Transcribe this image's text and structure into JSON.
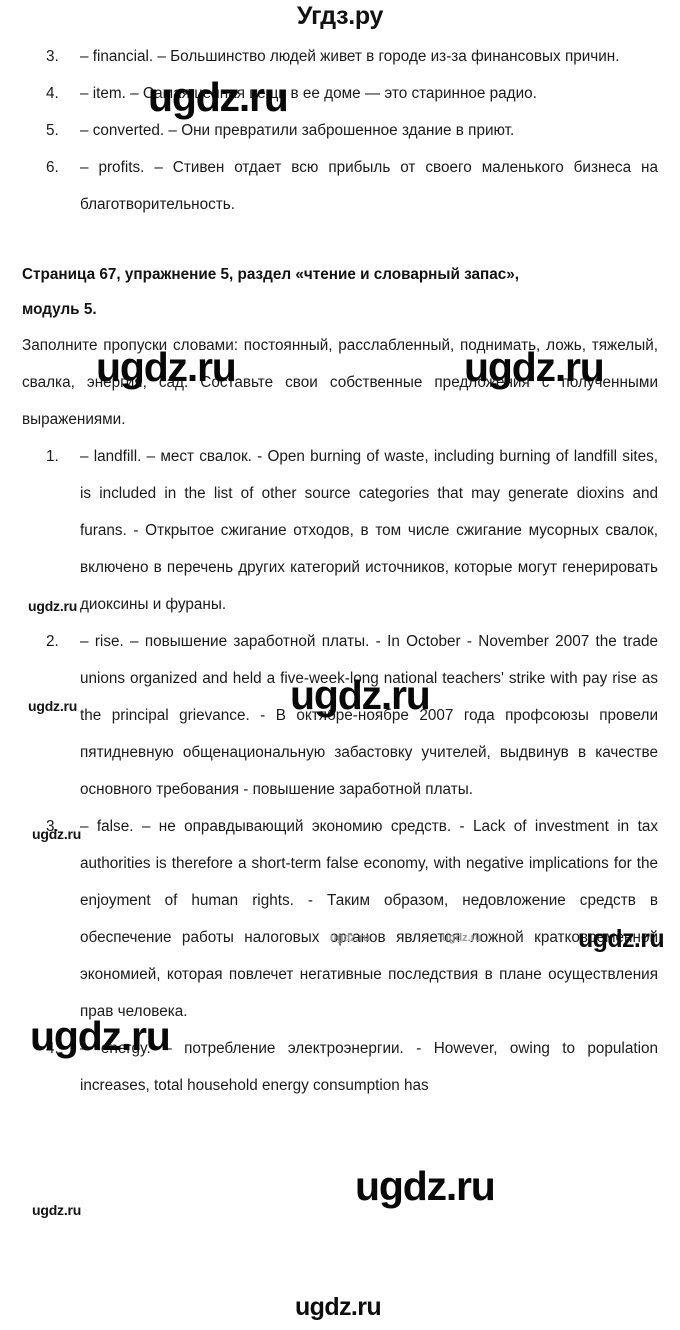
{
  "site": {
    "header_brand": "Угдз.ру",
    "watermark_text": "ugdz.ru"
  },
  "document": {
    "top_list": [
      {
        "num": "3.",
        "text": "– financial. – Большинство людей живет в городе из-за финансовых причин."
      },
      {
        "num": "4.",
        "text": "– item. – Самая ценная вещь в ее доме — это старинное радио."
      },
      {
        "num": "5.",
        "text": "– converted. – Они превратили заброшенное здание в приют."
      },
      {
        "num": "6.",
        "text": "– profits. – Стивен отдает всю прибыль от своего маленького бизнеса на благотворительность."
      }
    ],
    "section_heading_line1": "Страница 67, упражнение 5, раздел «чтение и словарный запас»,",
    "section_heading_line2": "модуль 5.",
    "task_intro": "Заполните пропуски словами: постоянный, расслабленный, поднимать, ложь, тяжелый, свалка, энергия, сад. Составьте свои собственные предложения с полученными выражениями.",
    "answers": [
      {
        "num": "1.",
        "text": "– landfill. – мест свалок. - Open burning of waste, including burning of landfill sites, is included in the list of other source categories that may generate dioxins and furans. - Открытое сжигание отходов, в том числе сжигание мусорных свалок, включено в перечень других категорий источников, которые могут генерировать диоксины и фураны."
      },
      {
        "num": "2.",
        "text": " – rise. – повышение заработной платы. - In October - November 2007 the trade unions organized and held a five-week-long national teachers' strike with pay rise as the principal grievance. - В октябре-ноябре 2007 года профсоюзы провели пятидневную общенациональную забастовку учителей, выдвинув в качестве основного требования - повышение заработной платы."
      },
      {
        "num": "3.",
        "text": "– false. – не оправдывающий экономию средств. - Lack of investment in tax authorities is therefore a short-term false economy, with negative implications for the enjoyment of human rights. - Таким образом, недовложение средств в обеспечение работы налоговых органов является ложной кратковременной экономией, которая повлечет негативные последствия в плане осуществления прав человека."
      },
      {
        "num": "4.",
        "text": "– energy. – потребление электроэнергии. - However, owing to population increases, total household energy consumption has"
      }
    ]
  },
  "watermarks": [
    {
      "id": "wm-1",
      "size": "big",
      "text": "ugdz.ru"
    },
    {
      "id": "wm-2",
      "size": "big",
      "text": "ugdz.ru"
    },
    {
      "id": "wm-3",
      "size": "big",
      "text": "ugdz.ru"
    },
    {
      "id": "wm-4",
      "size": "small",
      "text": "ugdz.ru"
    },
    {
      "id": "wm-5",
      "size": "big",
      "text": "ugdz.ru"
    },
    {
      "id": "wm-6",
      "size": "small",
      "text": "ugdz.ru"
    },
    {
      "id": "wm-7",
      "size": "small",
      "text": "ugdz.ru"
    },
    {
      "id": "wm-8",
      "size": "tiny",
      "text": "ugdz.ru"
    },
    {
      "id": "wm-9",
      "size": "tiny",
      "text": "ugdz.ru"
    },
    {
      "id": "wm-10",
      "size": "mid",
      "text": "ugdz.ru"
    },
    {
      "id": "wm-11",
      "size": "big",
      "text": "ugdz.ru"
    },
    {
      "id": "wm-12",
      "size": "big",
      "text": "ugdz.ru"
    },
    {
      "id": "wm-13",
      "size": "small",
      "text": "ugdz.ru"
    },
    {
      "id": "wm-14",
      "size": "mid",
      "text": "ugdz.ru"
    }
  ]
}
